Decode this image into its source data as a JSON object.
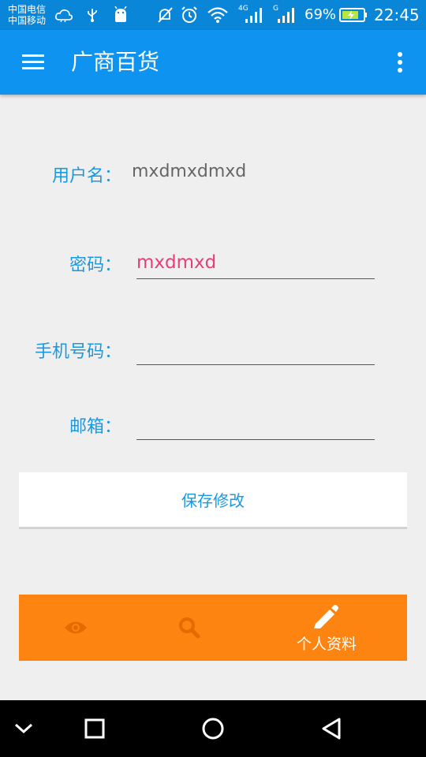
{
  "status_bar": {
    "carrier_1": "中国电信",
    "carrier_2": "中国移动",
    "net_4g": "4G",
    "net_g": "G",
    "battery": "69%",
    "time": "22:45",
    "icons": [
      "cloud-icon",
      "usb-icon",
      "android-icon",
      "mute-icon",
      "alarm-icon",
      "wifi-icon",
      "signal-icon",
      "battery-icon"
    ]
  },
  "app_bar": {
    "title": "广商百货",
    "menu_icon": "hamburger-menu-icon",
    "overflow_icon": "more-vert-icon"
  },
  "form": {
    "username_label": "用户名：",
    "username_value": "mxdmxdmxd",
    "password_label": "密码：",
    "password_value": "mxdmxd",
    "phone_label": "手机号码：",
    "phone_value": "",
    "email_label": "邮箱：",
    "email_value": ""
  },
  "save_button": {
    "label": "保存修改"
  },
  "tabs": [
    {
      "icon": "eye-icon",
      "label": ""
    },
    {
      "icon": "search-icon",
      "label": ""
    },
    {
      "icon": "pencil-icon",
      "label": "个人资料"
    }
  ],
  "colors": {
    "status_bar": "#0A86D8",
    "app_bar": "#0E94F0",
    "accent": "#1B99E0",
    "input_text": "#E83E78",
    "tab_bar": "#FD8410",
    "background": "#EFEFEF"
  },
  "nav_bar": {
    "icons": [
      "chevron-down-icon",
      "recents-square-icon",
      "home-circle-icon",
      "back-triangle-icon"
    ]
  }
}
